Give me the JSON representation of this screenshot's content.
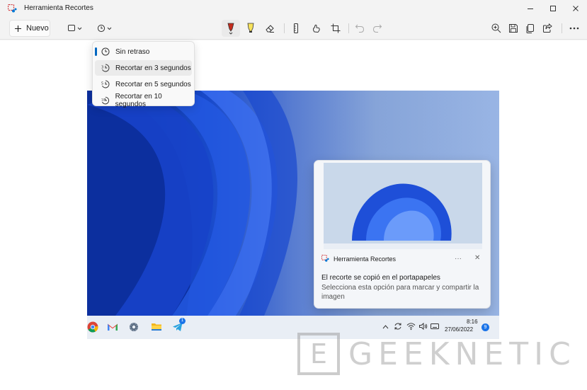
{
  "window": {
    "title": "Herramienta Recortes"
  },
  "toolbar": {
    "new_label": "Nuevo",
    "pen_color": "#c42b1c",
    "highlighter_color": "#f7e25c"
  },
  "delay_menu": {
    "items": [
      {
        "label": "Sin retraso",
        "icon": "clock-icon",
        "selected": true
      },
      {
        "label": "Recortar en 3 segundos",
        "icon": "clock-3-icon",
        "hover": true
      },
      {
        "label": "Recortar en 5 segundos",
        "icon": "clock-5-icon"
      },
      {
        "label": "Recortar en 10 segundos",
        "icon": "clock-10-icon"
      }
    ],
    "accent": "#0067c0"
  },
  "screenshot": {
    "notification": {
      "app_name": "Herramienta Recortes",
      "more": "···",
      "close": "✕",
      "title": "El recorte se copió en el portapapeles",
      "body": "Selecciona esta opción para marcar y compartir la imagen"
    },
    "taskbar": {
      "telegram_badge": "1",
      "time": "8:16",
      "date": "27/06/2022",
      "notification_count": "9"
    }
  },
  "watermark": {
    "text": "GEEKNETIC",
    "box_letter": "E"
  }
}
